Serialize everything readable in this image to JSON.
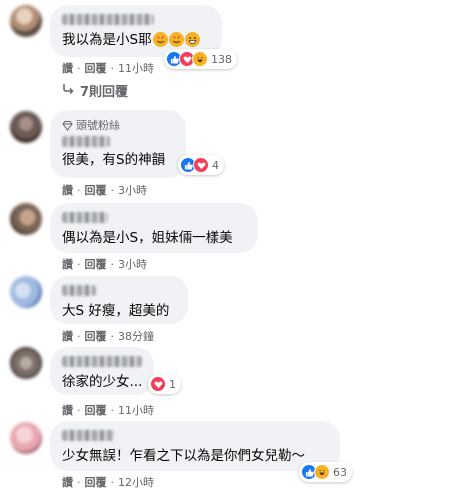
{
  "actions": {
    "like": "讚",
    "reply": "回覆"
  },
  "comments": [
    {
      "text": "我以為是小S耶",
      "time": "11小時",
      "reactions": {
        "count": "138",
        "types": [
          "like",
          "love",
          "haha"
        ]
      },
      "avatar_colors": [
        "#5a4a3e",
        "#b08d74",
        "#e6d2bf"
      ]
    },
    {
      "badge": "頭號粉絲",
      "text": "很美，有S的神韻",
      "time": "3小時",
      "reactions": {
        "count": "4",
        "types": [
          "like",
          "love"
        ]
      },
      "avatar_colors": [
        "#6b5a55",
        "#3e2e2a",
        "#a89088"
      ]
    },
    {
      "text": "偶以為是小S，姐妹倆一樣美",
      "time": "3小時",
      "avatar_colors": [
        "#4a3a30",
        "#c4a48c",
        "#7b6555"
      ]
    },
    {
      "text": "大S 好瘦，超美的",
      "time": "38分鐘",
      "avatar_colors": [
        "#9fb9e0",
        "#d6e2f2",
        "#5f7fb8"
      ]
    },
    {
      "text": "徐家的少女...",
      "time": "11小時",
      "reactions": {
        "count": "1",
        "types": [
          "love"
        ]
      },
      "avatar_colors": [
        "#7a6e68",
        "#b8aaa2",
        "#3f3733"
      ]
    },
    {
      "text": "少女無誤！乍看之下以為是你們女兒勒～",
      "time": "12小時",
      "reactions": {
        "count": "63",
        "types": [
          "like",
          "haha"
        ]
      },
      "avatar_colors": [
        "#e8a7b0",
        "#f6d4d8",
        "#b06a77"
      ]
    }
  ],
  "replies_link": {
    "label": "7則回覆",
    "icon": "reply-arrow-icon"
  },
  "inline_emojis": [
    "heart-eyes",
    "heart-eyes",
    "grinning"
  ]
}
